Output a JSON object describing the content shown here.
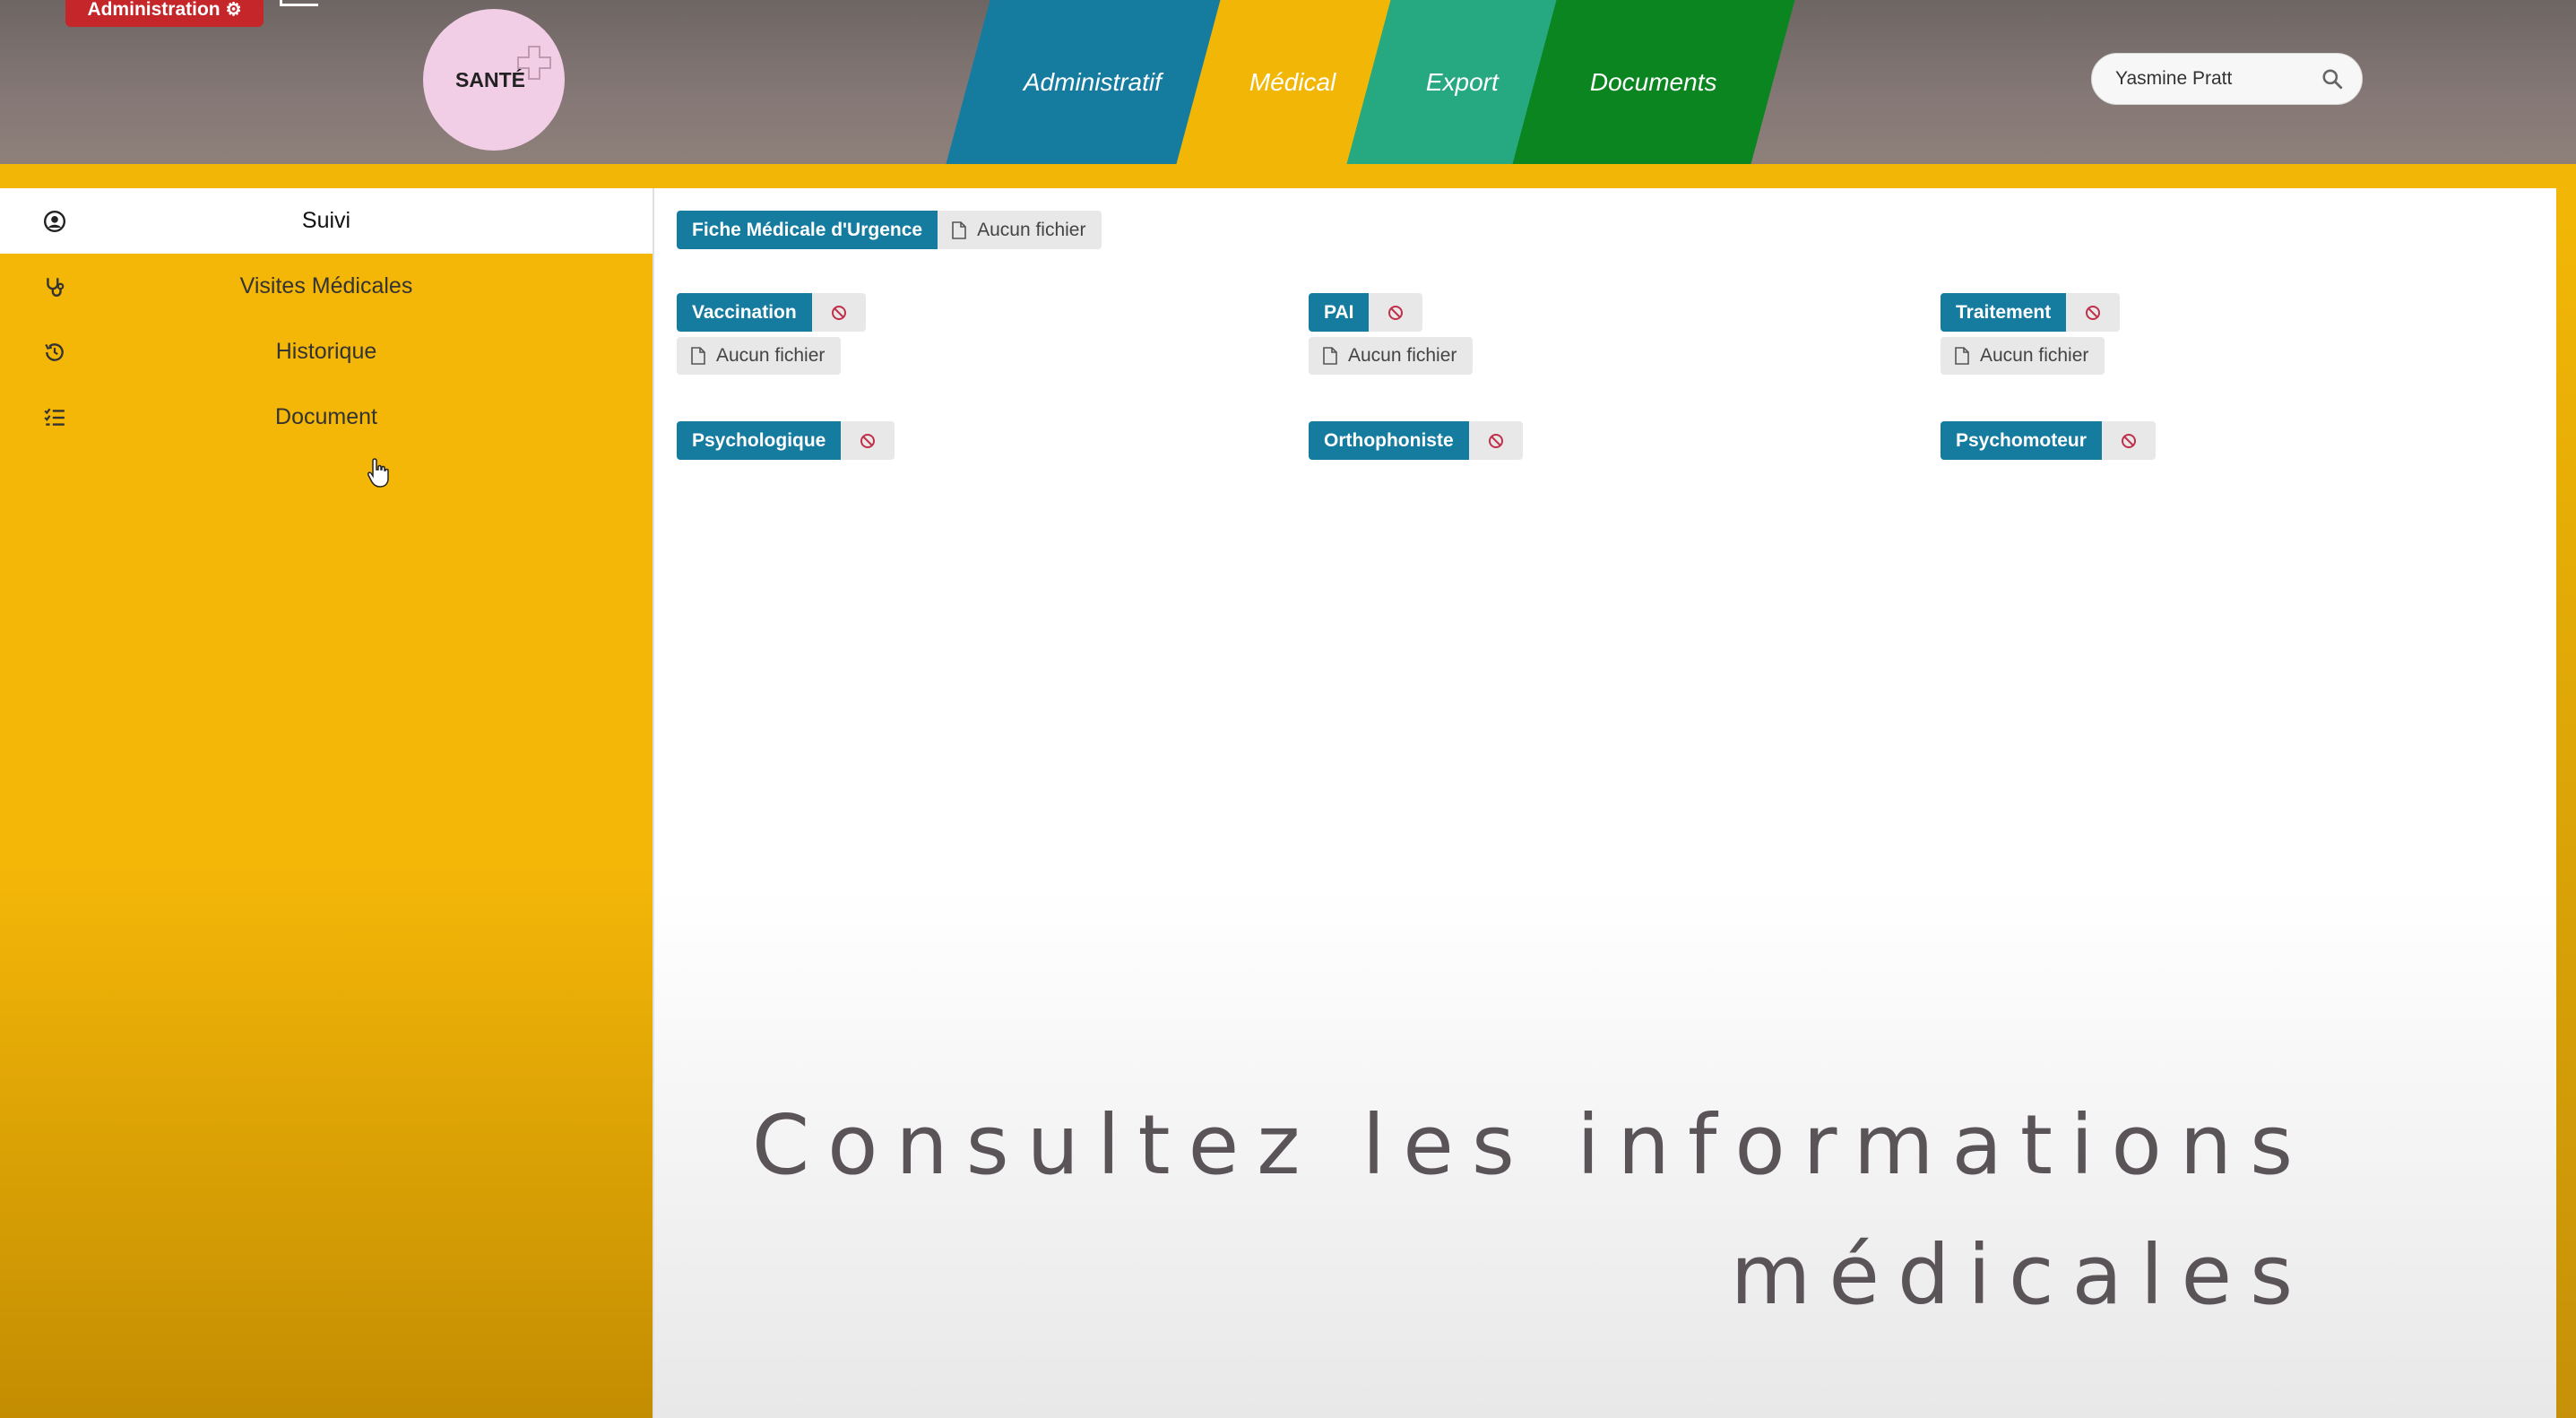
{
  "header": {
    "admin_badge": "Administration",
    "logo_text": "SANTÉ",
    "nav_tabs": [
      {
        "label": "Administratif",
        "color": "#157ca0"
      },
      {
        "label": "Médical",
        "color": "#f2b706"
      },
      {
        "label": "Export",
        "color": "#26a881"
      },
      {
        "label": "Documents",
        "color": "#0b8520"
      }
    ],
    "search_value": "Yasmine Pratt"
  },
  "sidebar": {
    "items": [
      {
        "label": "Suivi",
        "icon": "user-circle-icon",
        "active": true
      },
      {
        "label": "Visites Médicales",
        "icon": "stethoscope-icon",
        "active": false
      },
      {
        "label": "Historique",
        "icon": "history-icon",
        "active": false
      },
      {
        "label": "Document",
        "icon": "list-check-icon",
        "active": false
      }
    ]
  },
  "main": {
    "urgent_sheet": {
      "label": "Fiche Médicale d'Urgence",
      "file": "Aucun fichier"
    },
    "records": [
      {
        "label": "Vaccination",
        "file": "Aucun fichier"
      },
      {
        "label": "PAI",
        "file": "Aucun fichier"
      },
      {
        "label": "Traitement",
        "file": "Aucun fichier"
      },
      {
        "label": "Psychologique"
      },
      {
        "label": "Orthophoniste"
      },
      {
        "label": "Psychomoteur"
      }
    ],
    "caption_line1": "Consultez les informations",
    "caption_line2": "médicales"
  },
  "colors": {
    "accent_blue": "#157ca0",
    "sidebar_yellow": "#f4b708",
    "ban_red": "#c0304a",
    "badge_red": "#c4262a"
  }
}
